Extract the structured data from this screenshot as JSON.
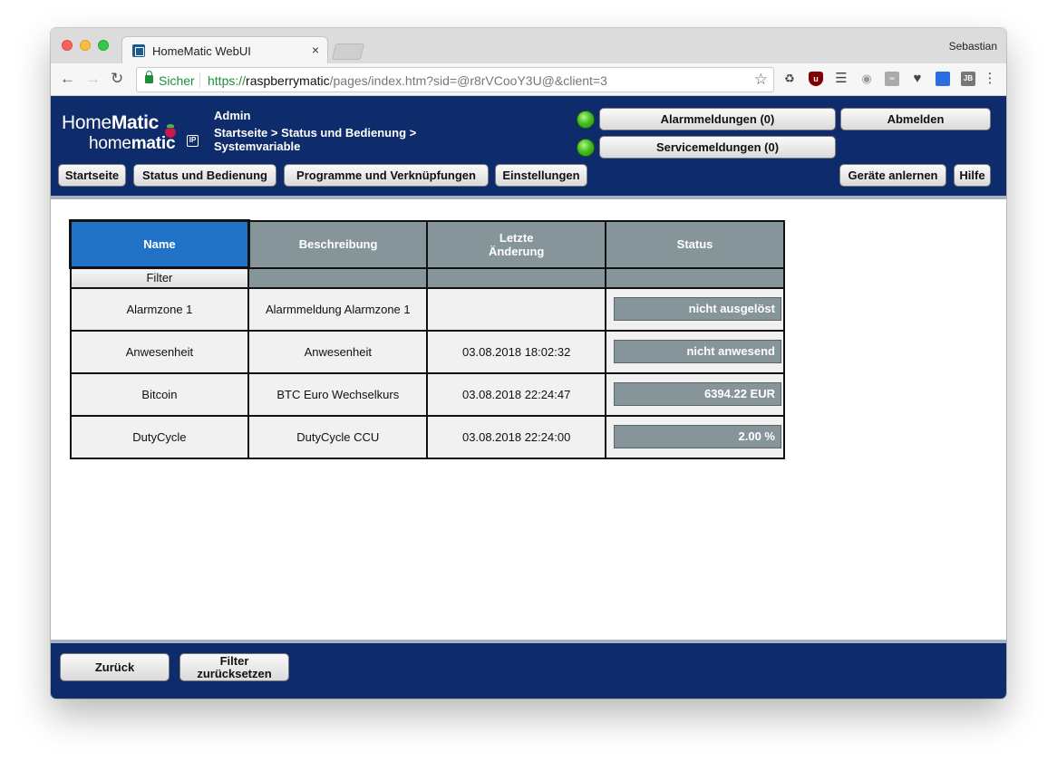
{
  "browser": {
    "tab_title": "HomeMatic WebUI",
    "tab_close": "×",
    "profile_name": "Sebastian",
    "secure_label": "Sicher",
    "url_scheme": "https://",
    "url_host": "raspberrymatic",
    "url_path": "/pages/index.htm?sid=@r8rVCooY3U@&client=3",
    "icons": [
      "back-icon",
      "forward-icon",
      "reload-icon",
      "lock-icon",
      "star-icon",
      "extension-icons",
      "menu-icon"
    ]
  },
  "header": {
    "logo_line1_light": "Home",
    "logo_line1_bold": "Matic",
    "logo_line2_light": "home",
    "logo_line2_bold": "matic",
    "logo_badge": "IP",
    "user": "Admin",
    "breadcrumb": "Startseite > Status und Bedienung > Systemvariable",
    "alarm_button": "Alarmmeldungen (0)",
    "service_button": "Servicemeldungen (0)",
    "logout_button": "Abmelden",
    "nav": {
      "home": "Startseite",
      "status": "Status und Bedienung",
      "programs": "Programme und Verknüpfungen",
      "settings": "Einstellungen",
      "teach_in": "Geräte anlernen",
      "help": "Hilfe"
    },
    "led_color": "#44c023",
    "header_bg": "#0e2c6b"
  },
  "table": {
    "columns": {
      "name": "Name",
      "description": "Beschreibung",
      "last_change_1": "Letzte",
      "last_change_2": "Änderung",
      "status": "Status"
    },
    "filter_label": "Filter",
    "rows": [
      {
        "name": "Alarmzone 1",
        "description": "Alarmmeldung Alarmzone 1",
        "last_change": "",
        "status": "nicht ausgelöst"
      },
      {
        "name": "Anwesenheit",
        "description": "Anwesenheit",
        "last_change": "03.08.2018 18:02:32",
        "status": "nicht anwesend"
      },
      {
        "name": "Bitcoin",
        "description": "BTC Euro Wechselkurs",
        "last_change": "03.08.2018 22:24:47",
        "status": "6394.22 EUR"
      },
      {
        "name": "DutyCycle",
        "description": "DutyCycle CCU",
        "last_change": "03.08.2018 22:24:00",
        "status": "2.00 %"
      }
    ],
    "active_header_color": "#1f72c6",
    "header_color": "#86959a"
  },
  "footer": {
    "back_button": "Zurück",
    "reset_filter_line1": "Filter",
    "reset_filter_line2": "zurücksetzen"
  }
}
